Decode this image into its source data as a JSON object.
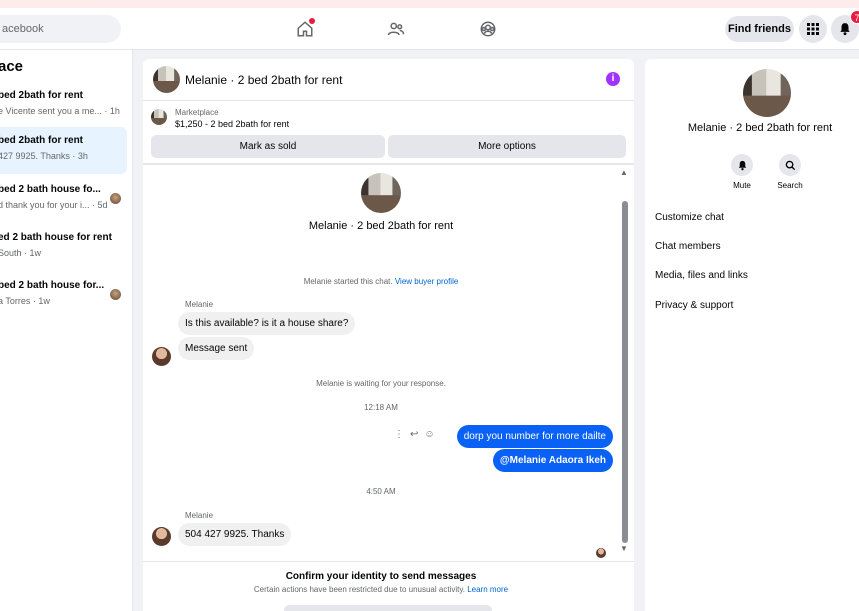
{
  "topbar": {
    "search_text": "acebook",
    "find_friends_label": "Find friends",
    "notifications_count": "7",
    "icons": [
      "home-icon",
      "friends-icon",
      "groups-icon",
      "menu-grid-icon",
      "bell-icon"
    ]
  },
  "left": {
    "title": "ace",
    "conversations": [
      {
        "title": "bed 2bath for rent",
        "preview": "e Vicente sent you a me... · 1h"
      },
      {
        "title": "bed 2bath for rent",
        "preview": "427 9925. Thanks · 3h"
      },
      {
        "title": "bed 2 bath house fo...",
        "preview": "d thank you for your i... · 5d"
      },
      {
        "title": "ed 2 bath house for rent",
        "preview": "South · 1w"
      },
      {
        "title": "bed 2 bath house for...",
        "preview": "a Torres · 1w"
      }
    ]
  },
  "chat": {
    "header_title": "Melanie · 2 bed 2bath for rent",
    "info_glyph": "i",
    "marketplace_label": "Marketplace",
    "listing": "$1,250 - 2 bed 2bath for rent",
    "mark_sold_label": "Mark as sold",
    "more_options_label": "More options",
    "profile_name": "Melanie · 2 bed 2bath for rent",
    "started_text": "Melanie started this chat.",
    "view_buyer_profile": "View buyer profile",
    "sender_name_1": "Melanie",
    "msg_in_1": "Is this available? is it a house share?",
    "msg_in_2": "Message sent",
    "waiting_text": "Melanie is waiting for your response.",
    "time_1": "12:18 AM",
    "msg_out_1": "dorp you number for more dailte",
    "msg_out_2": "@Melanie Adaora Ikeh",
    "time_2": "4:50 AM",
    "sender_name_2": "Melanie",
    "msg_in_3": "504 427 9925. Thanks",
    "confirm_title": "Confirm your identity to send messages",
    "confirm_text": "Certain actions have been restricted due to unusual activity.",
    "learn_more": "Learn more"
  },
  "right": {
    "name": "Melanie · 2 bed 2bath for rent",
    "mute_label": "Mute",
    "search_label": "Search",
    "links": [
      "Customize chat",
      "Chat members",
      "Media, files and links",
      "Privacy & support"
    ]
  }
}
